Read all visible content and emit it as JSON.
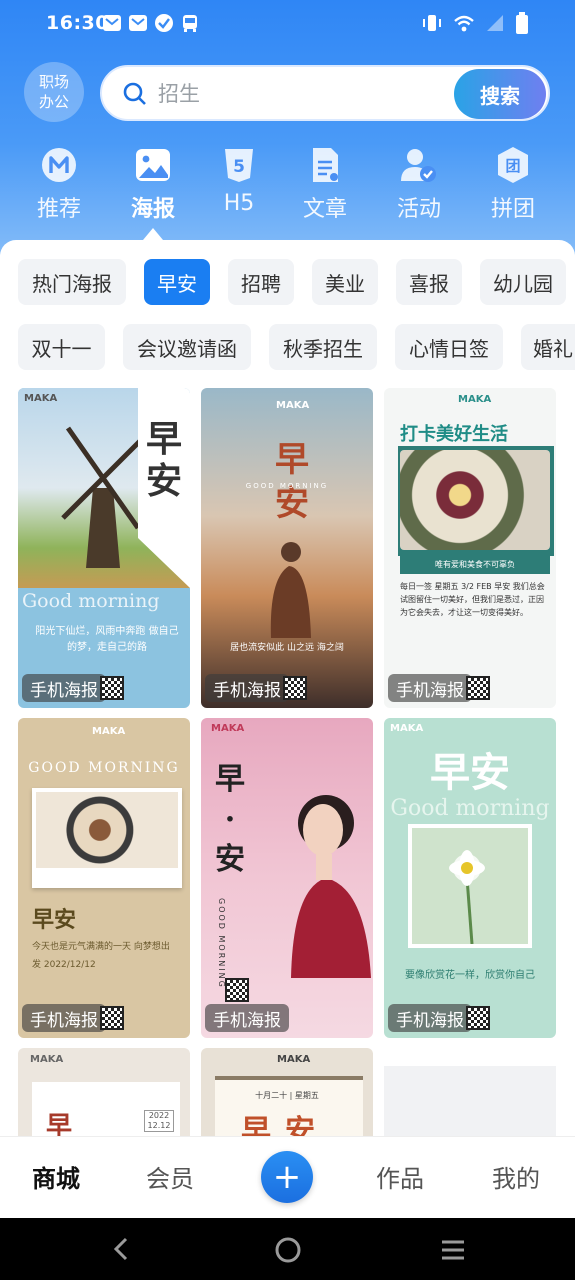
{
  "status": {
    "time": "16:30"
  },
  "header": {
    "workplace_label": "职场办公",
    "search_placeholder": "招生",
    "search_button": "搜索"
  },
  "categories": [
    {
      "label": "推荐",
      "icon": "recommend-m-icon"
    },
    {
      "label": "海报",
      "icon": "poster-image-icon",
      "active": true
    },
    {
      "label": "H5",
      "icon": "h5-icon"
    },
    {
      "label": "文章",
      "icon": "article-icon"
    },
    {
      "label": "活动",
      "icon": "activity-user-icon"
    },
    {
      "label": "拼团",
      "icon": "group-buy-icon"
    }
  ],
  "chips_row1": [
    "热门海报",
    "早安",
    "招聘",
    "美业",
    "喜报",
    "幼儿园"
  ],
  "chips_row2": [
    "双十一",
    "会议邀请函",
    "秋季招生",
    "心情日签",
    "婚礼"
  ],
  "active_chip": "早安",
  "cards": [
    {
      "tag": "手机海报",
      "brand": "MAKA",
      "title": "早安",
      "subtitle": "Good morning",
      "text": "阳光下仙烂，风雨中奔跑 做自己的梦，走自己的路"
    },
    {
      "tag": "手机海报",
      "brand": "MAKA",
      "title": "早安",
      "subtitle": "GOOD MORNING",
      "text": "居也流安似此 山之远 海之阔"
    },
    {
      "tag": "手机海报",
      "brand": "MAKA",
      "title": "打卡美好生活",
      "subtitle": "唯有爱和美食不可辜负",
      "text": "每日一签 星期五 3/2 FEB 早安 我们总会试图留住一切美好，但我们是悉过，正因为它会失去，才让这一切变得美好。"
    },
    {
      "tag": "手机海报",
      "brand": "MAKA",
      "title": "早安",
      "subtitle": "GOOD MORNING",
      "text": "今天也是元气满满的一天 向梦想出发 2022/12/12"
    },
    {
      "tag": "手机海报",
      "brand": "MAKA",
      "title": "早·安",
      "subtitle": "GOOD MORNING",
      "text": ""
    },
    {
      "tag": "手机海报",
      "brand": "MAKA",
      "title": "早安",
      "subtitle": "Good morning",
      "text": "要像欣赏花一样，欣赏你自己"
    },
    {
      "tag": "",
      "brand": "MAKA",
      "title": "早",
      "subtitle": "2022 12.12",
      "text": ""
    },
    {
      "tag": "",
      "brand": "MAKA",
      "title": "早安",
      "subtitle": "十月二十 | 星期五",
      "text": ""
    }
  ],
  "tabbar": {
    "shop": "商城",
    "member": "会员",
    "works": "作品",
    "mine": "我的",
    "add": "+"
  }
}
